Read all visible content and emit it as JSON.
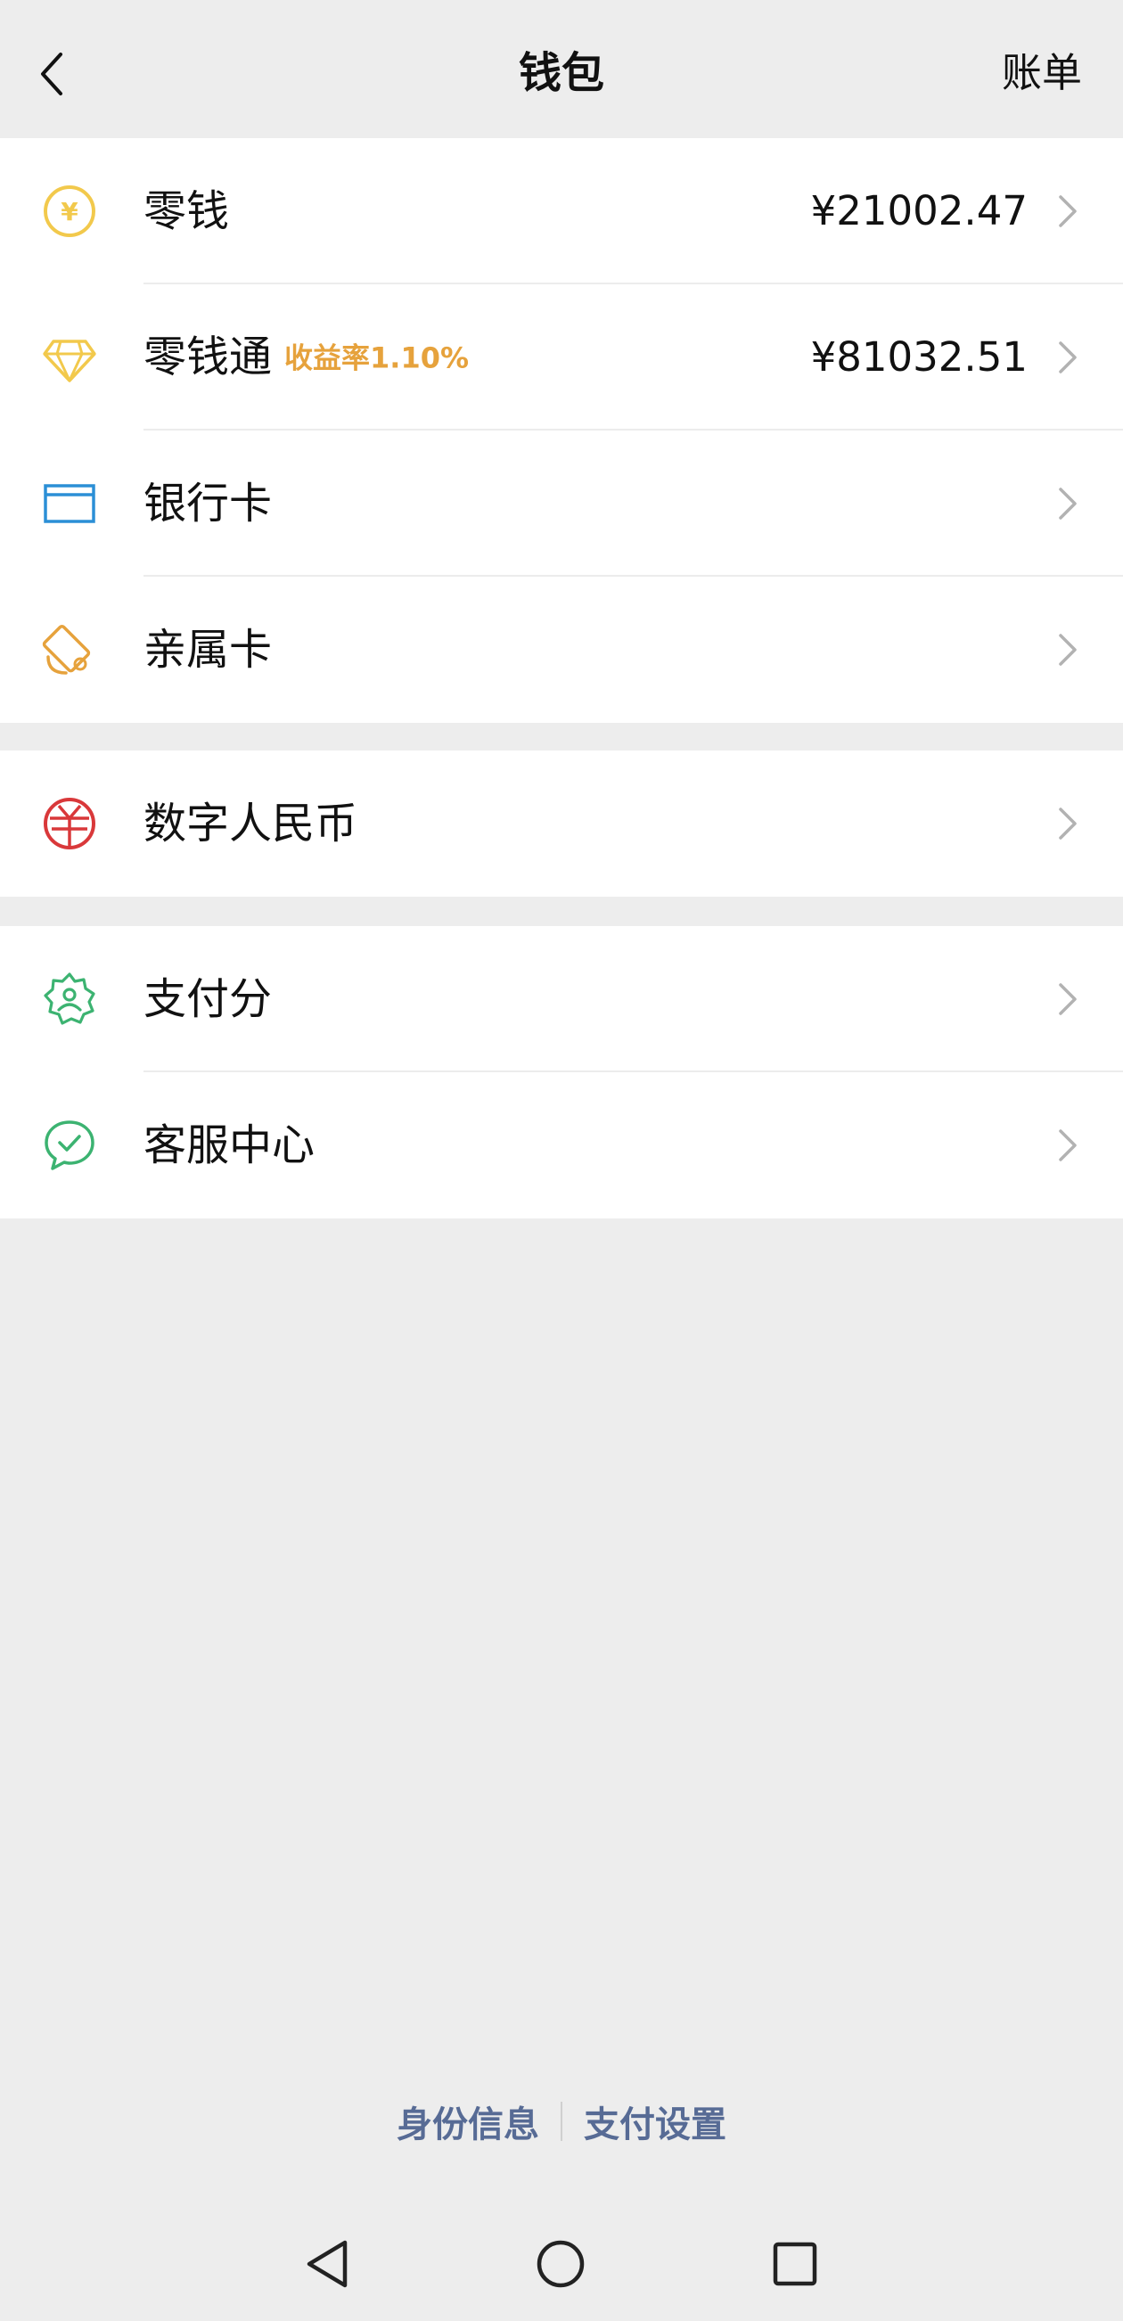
{
  "header": {
    "title": "钱包",
    "bill_label": "账单"
  },
  "groups": [
    {
      "items": [
        {
          "label": "零钱",
          "value": "¥21002.47",
          "icon": "yen-coin-icon",
          "color": "#f2c94c"
        },
        {
          "label": "零钱通",
          "badge": "收益率1.10%",
          "value": "¥81032.51",
          "icon": "diamond-icon",
          "color": "#f2c94c"
        },
        {
          "label": "银行卡",
          "icon": "bank-card-icon",
          "color": "#2b8fd6"
        },
        {
          "label": "亲属卡",
          "icon": "family-card-icon",
          "color": "#e6a23c"
        }
      ]
    },
    {
      "items": [
        {
          "label": "数字人民币",
          "icon": "digital-rmb-icon",
          "color": "#d9383a"
        }
      ]
    },
    {
      "items": [
        {
          "label": "支付分",
          "icon": "pay-score-icon",
          "color": "#3cb371"
        },
        {
          "label": "客服中心",
          "icon": "customer-service-icon",
          "color": "#3cb371"
        }
      ]
    }
  ],
  "footer": {
    "identity_label": "身份信息",
    "payment_settings_label": "支付设置"
  },
  "colors": {
    "background": "#ededed",
    "link": "#576b95",
    "badge": "#e6a23c"
  },
  "system_nav": [
    "back-triangle-icon",
    "home-circle-icon",
    "recents-square-icon"
  ]
}
